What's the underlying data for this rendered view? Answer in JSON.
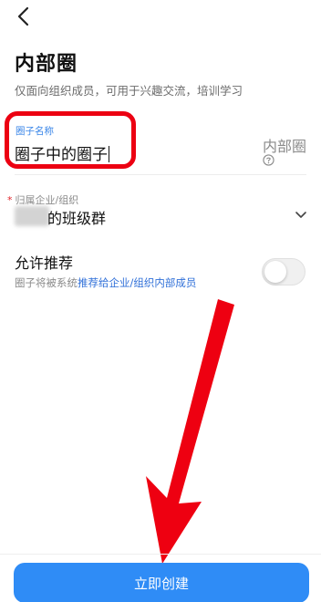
{
  "header": {
    "title": "内部圈",
    "description": "仅面向组织成员，可用于兴趣交流，培训学习"
  },
  "name_field": {
    "label": "圈子名称",
    "value": "圈子中的圈子",
    "type_label": "内部圈"
  },
  "org_field": {
    "required_mark": "*",
    "label": "归属企业/组织",
    "value": "的班级群"
  },
  "allow_recommend": {
    "title": "允许推荐",
    "desc_prefix": "圈子将被系统",
    "desc_link": "推荐给企业/组织内部成员",
    "enabled": false
  },
  "footer": {
    "create_label": "立即创建"
  },
  "colors": {
    "accent": "#2f8cf6",
    "link": "#2f6fd8",
    "highlight": "#ec0012"
  },
  "icons": {
    "back": "chevron-left-icon",
    "help": "question-circle-icon",
    "expand": "chevron-down-icon",
    "annotation": "arrow-down-left-icon"
  }
}
